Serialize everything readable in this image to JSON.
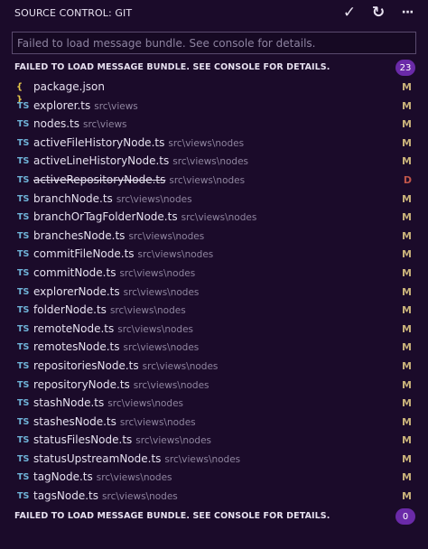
{
  "header": {
    "title": "SOURCE CONTROL: GIT",
    "actions": [
      {
        "icon": "check-icon",
        "glyph": "✓"
      },
      {
        "icon": "refresh-icon",
        "glyph": "↻"
      },
      {
        "icon": "more-icon",
        "glyph": "···"
      }
    ]
  },
  "message_input": {
    "placeholder": "Failed to load message bundle. See console for details."
  },
  "changes_group": {
    "label": "FAILED TO LOAD MESSAGE BUNDLE. SEE CONSOLE FOR DETAILS.",
    "count": "23"
  },
  "files": [
    {
      "icon": "json-icon",
      "glyph": "{ }",
      "name": "package.json",
      "path": "",
      "status": "M",
      "deleted": false
    },
    {
      "icon": "ts-icon",
      "glyph": "TS",
      "name": "explorer.ts",
      "path": "src\\views",
      "status": "M",
      "deleted": false
    },
    {
      "icon": "ts-icon",
      "glyph": "TS",
      "name": "nodes.ts",
      "path": "src\\views",
      "status": "M",
      "deleted": false
    },
    {
      "icon": "ts-icon",
      "glyph": "TS",
      "name": "activeFileHistoryNode.ts",
      "path": "src\\views\\nodes",
      "status": "M",
      "deleted": false
    },
    {
      "icon": "ts-icon",
      "glyph": "TS",
      "name": "activeLineHistoryNode.ts",
      "path": "src\\views\\nodes",
      "status": "M",
      "deleted": false
    },
    {
      "icon": "ts-icon",
      "glyph": "TS",
      "name": "activeRepositoryNode.ts",
      "path": "src\\views\\nodes",
      "status": "D",
      "deleted": true
    },
    {
      "icon": "ts-icon",
      "glyph": "TS",
      "name": "branchNode.ts",
      "path": "src\\views\\nodes",
      "status": "M",
      "deleted": false
    },
    {
      "icon": "ts-icon",
      "glyph": "TS",
      "name": "branchOrTagFolderNode.ts",
      "path": "src\\views\\nodes",
      "status": "M",
      "deleted": false
    },
    {
      "icon": "ts-icon",
      "glyph": "TS",
      "name": "branchesNode.ts",
      "path": "src\\views\\nodes",
      "status": "M",
      "deleted": false
    },
    {
      "icon": "ts-icon",
      "glyph": "TS",
      "name": "commitFileNode.ts",
      "path": "src\\views\\nodes",
      "status": "M",
      "deleted": false
    },
    {
      "icon": "ts-icon",
      "glyph": "TS",
      "name": "commitNode.ts",
      "path": "src\\views\\nodes",
      "status": "M",
      "deleted": false
    },
    {
      "icon": "ts-icon",
      "glyph": "TS",
      "name": "explorerNode.ts",
      "path": "src\\views\\nodes",
      "status": "M",
      "deleted": false
    },
    {
      "icon": "ts-icon",
      "glyph": "TS",
      "name": "folderNode.ts",
      "path": "src\\views\\nodes",
      "status": "M",
      "deleted": false
    },
    {
      "icon": "ts-icon",
      "glyph": "TS",
      "name": "remoteNode.ts",
      "path": "src\\views\\nodes",
      "status": "M",
      "deleted": false
    },
    {
      "icon": "ts-icon",
      "glyph": "TS",
      "name": "remotesNode.ts",
      "path": "src\\views\\nodes",
      "status": "M",
      "deleted": false
    },
    {
      "icon": "ts-icon",
      "glyph": "TS",
      "name": "repositoriesNode.ts",
      "path": "src\\views\\nodes",
      "status": "M",
      "deleted": false
    },
    {
      "icon": "ts-icon",
      "glyph": "TS",
      "name": "repositoryNode.ts",
      "path": "src\\views\\nodes",
      "status": "M",
      "deleted": false
    },
    {
      "icon": "ts-icon",
      "glyph": "TS",
      "name": "stashNode.ts",
      "path": "src\\views\\nodes",
      "status": "M",
      "deleted": false
    },
    {
      "icon": "ts-icon",
      "glyph": "TS",
      "name": "stashesNode.ts",
      "path": "src\\views\\nodes",
      "status": "M",
      "deleted": false
    },
    {
      "icon": "ts-icon",
      "glyph": "TS",
      "name": "statusFilesNode.ts",
      "path": "src\\views\\nodes",
      "status": "M",
      "deleted": false
    },
    {
      "icon": "ts-icon",
      "glyph": "TS",
      "name": "statusUpstreamNode.ts",
      "path": "src\\views\\nodes",
      "status": "M",
      "deleted": false
    },
    {
      "icon": "ts-icon",
      "glyph": "TS",
      "name": "tagNode.ts",
      "path": "src\\views\\nodes",
      "status": "M",
      "deleted": false
    },
    {
      "icon": "ts-icon",
      "glyph": "TS",
      "name": "tagsNode.ts",
      "path": "src\\views\\nodes",
      "status": "M",
      "deleted": false
    }
  ],
  "staged_group": {
    "label": "FAILED TO LOAD MESSAGE BUNDLE. SEE CONSOLE FOR DETAILS.",
    "count": "0"
  },
  "colors": {
    "modified": "#c9b27a",
    "deleted": "#c0564a",
    "badge": "#6a2aa8",
    "background": "#1b0b2a"
  }
}
